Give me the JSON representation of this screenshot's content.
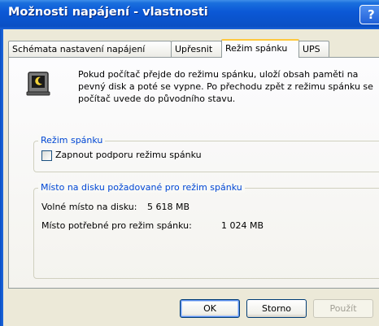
{
  "window": {
    "title": "Možnosti napájení - vlastnosti",
    "help_label": "?"
  },
  "tabs": [
    {
      "label": "Schémata nastavení napájení",
      "active": false
    },
    {
      "label": "Upřesnit",
      "active": false
    },
    {
      "label": "Režim spánku",
      "active": true
    },
    {
      "label": "UPS",
      "active": false
    }
  ],
  "info": {
    "icon": "hibernate-computer-icon",
    "text": "Pokud počítač přejde do režimu spánku, uloží obsah paměti na pevný disk a poté se vypne. Po přechodu zpět z režimu spánku se počítač uvede do původního stavu."
  },
  "sleep_group": {
    "legend": "Režim spánku",
    "checkbox_label": "Zapnout podporu režimu spánku",
    "checked": false
  },
  "disk_group": {
    "legend": "Místo na disku požadované pro režim spánku",
    "free_label": "Volné místo na disku:",
    "free_value": "5 618 MB",
    "required_label": "Místo potřebné pro režim spánku:",
    "required_value": "1 024 MB"
  },
  "buttons": {
    "ok": "OK",
    "cancel": "Storno",
    "apply": "Použít"
  }
}
